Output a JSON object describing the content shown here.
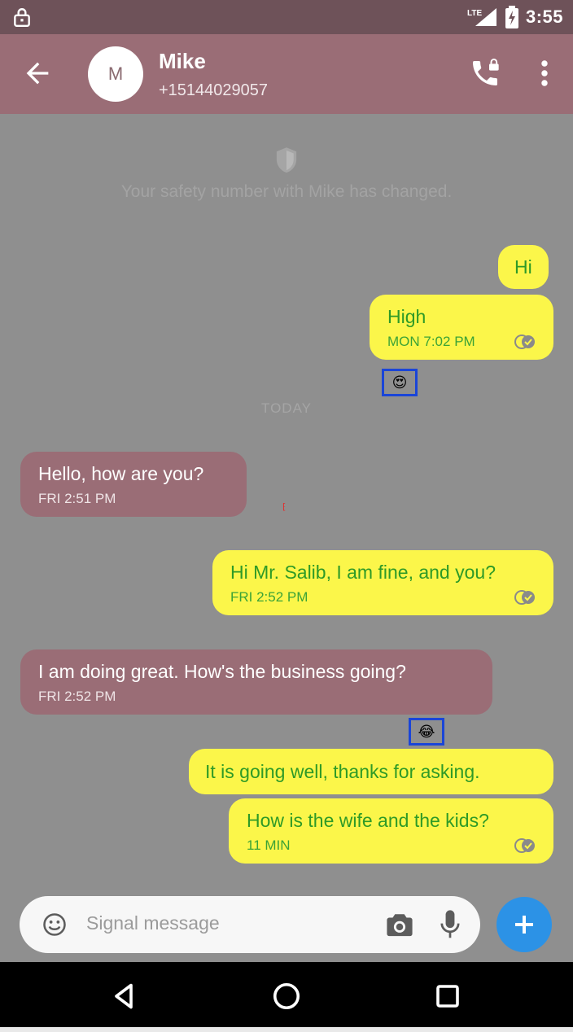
{
  "status_bar": {
    "network": "LTE",
    "time": "3:55"
  },
  "header": {
    "avatar_letter": "M",
    "name": "Mike",
    "number": "+15144029057"
  },
  "safety_notice": {
    "text": "Your safety number with Mike has changed."
  },
  "date_divider": "TODAY",
  "messages": [
    {
      "direction": "outgoing",
      "text": "Hi",
      "meta": ""
    },
    {
      "direction": "outgoing",
      "text": "High",
      "meta": "MON 7:02 PM",
      "delivered": true
    },
    {
      "direction": "incoming",
      "text": "Hello, how are you?",
      "meta": "FRI 2:51 PM"
    },
    {
      "direction": "outgoing",
      "text": "Hi Mr. Salib, I am fine, and you?",
      "meta": "FRI 2:52 PM",
      "delivered": true
    },
    {
      "direction": "incoming",
      "text": "I am doing great. How's the business going?",
      "meta": "FRI 2:52 PM"
    },
    {
      "direction": "outgoing",
      "text": "It is going well, thanks for asking.",
      "meta": ""
    },
    {
      "direction": "outgoing",
      "text": "How is the wife and the kids?",
      "meta": "11 MIN",
      "delivered": true
    }
  ],
  "reactions": [
    {
      "emoji": "😍",
      "icon": "heart-eyes-emoji"
    },
    {
      "emoji": "😂",
      "icon": "tears-of-joy-emoji"
    }
  ],
  "compose": {
    "placeholder": "Signal message"
  },
  "colors": {
    "outgoing_bubble": "#fbf64a",
    "outgoing_text": "#2e9a27",
    "incoming_bubble": "#9a6d76",
    "toolbar": "#9a6d76",
    "fab": "#2c92e6"
  }
}
